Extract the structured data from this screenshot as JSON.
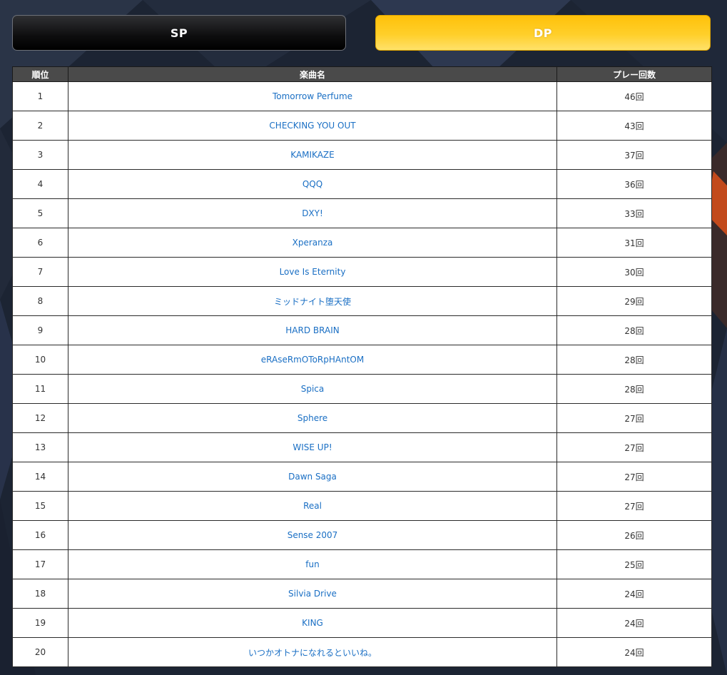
{
  "tabs": [
    {
      "label": "SP",
      "active": false
    },
    {
      "label": "DP",
      "active": true
    }
  ],
  "colors": {
    "active_tab": "#ffc61a",
    "inactive_tab": "#111111",
    "header_bg": "#4a4a4a",
    "link": "#1a6fc4"
  },
  "table": {
    "headers": {
      "rank": "順位",
      "title": "楽曲名",
      "plays": "プレー回数"
    },
    "rows": [
      {
        "rank": "1",
        "title": "Tomorrow Perfume",
        "plays": "46回"
      },
      {
        "rank": "2",
        "title": "CHECKING YOU OUT",
        "plays": "43回"
      },
      {
        "rank": "3",
        "title": "KAMIKAZE",
        "plays": "37回"
      },
      {
        "rank": "4",
        "title": "QQQ",
        "plays": "36回"
      },
      {
        "rank": "5",
        "title": "DXY!",
        "plays": "33回"
      },
      {
        "rank": "6",
        "title": "Xperanza",
        "plays": "31回"
      },
      {
        "rank": "7",
        "title": "Love Is Eternity",
        "plays": "30回"
      },
      {
        "rank": "8",
        "title": "ミッドナイト堕天使",
        "plays": "29回"
      },
      {
        "rank": "9",
        "title": "HARD BRAIN",
        "plays": "28回"
      },
      {
        "rank": "10",
        "title": "eRAseRmOToRpHAntOM",
        "plays": "28回"
      },
      {
        "rank": "11",
        "title": "Spica",
        "plays": "28回"
      },
      {
        "rank": "12",
        "title": "Sphere",
        "plays": "27回"
      },
      {
        "rank": "13",
        "title": "WISE UP!",
        "plays": "27回"
      },
      {
        "rank": "14",
        "title": "Dawn Saga",
        "plays": "27回"
      },
      {
        "rank": "15",
        "title": "Real",
        "plays": "27回"
      },
      {
        "rank": "16",
        "title": "Sense 2007",
        "plays": "26回"
      },
      {
        "rank": "17",
        "title": "fun",
        "plays": "25回"
      },
      {
        "rank": "18",
        "title": "Silvia Drive",
        "plays": "24回"
      },
      {
        "rank": "19",
        "title": "KING",
        "plays": "24回"
      },
      {
        "rank": "20",
        "title": "いつかオトナになれるといいね。",
        "plays": "24回"
      }
    ]
  }
}
